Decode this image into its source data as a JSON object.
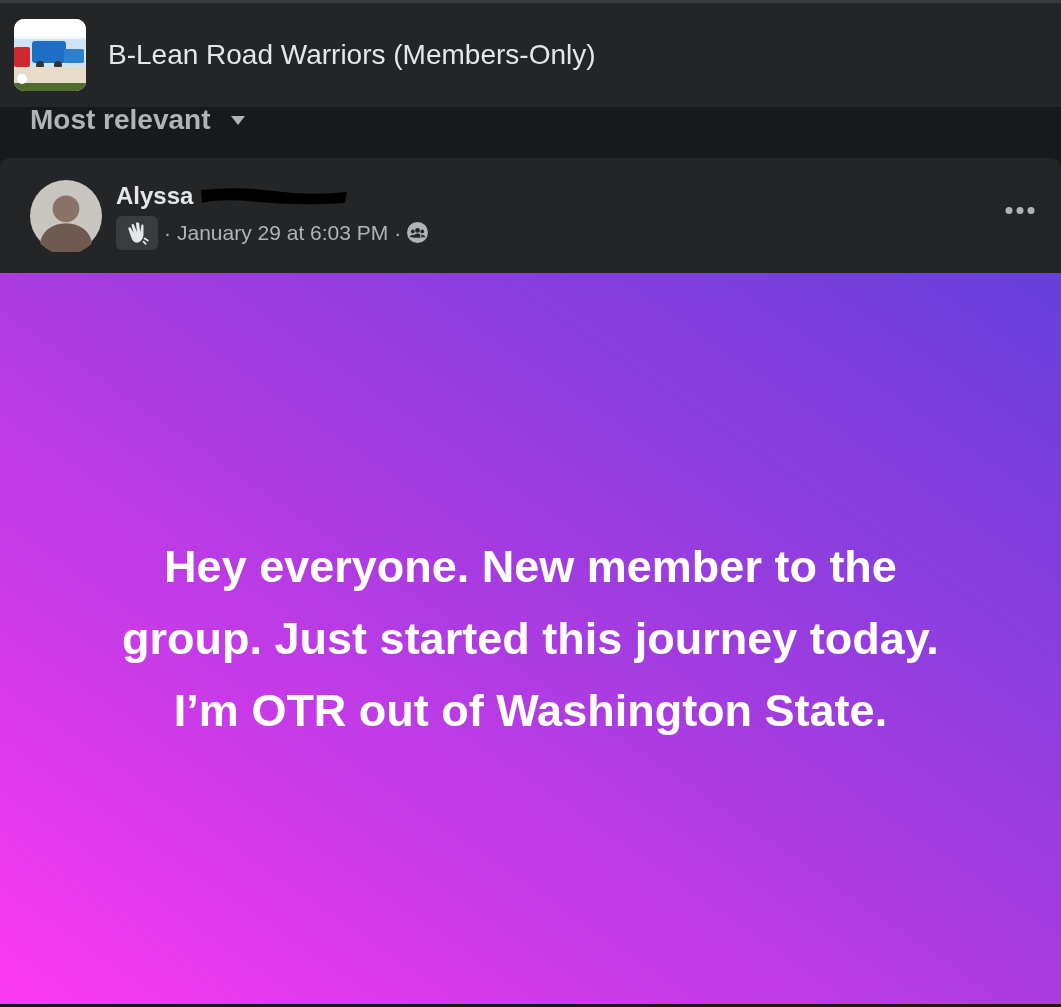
{
  "group": {
    "name": "B-Lean Road Warriors (Members-Only)"
  },
  "sort": {
    "label": "Most relevant"
  },
  "post": {
    "author": "Alyssa",
    "author_redacted": true,
    "timestamp": "January 29 at 6:03 PM",
    "separator_1": "·",
    "separator_2": "·",
    "text": "Hey everyone. New member to the group. Just started this journey today. I’m OTR out of Washington State."
  }
}
